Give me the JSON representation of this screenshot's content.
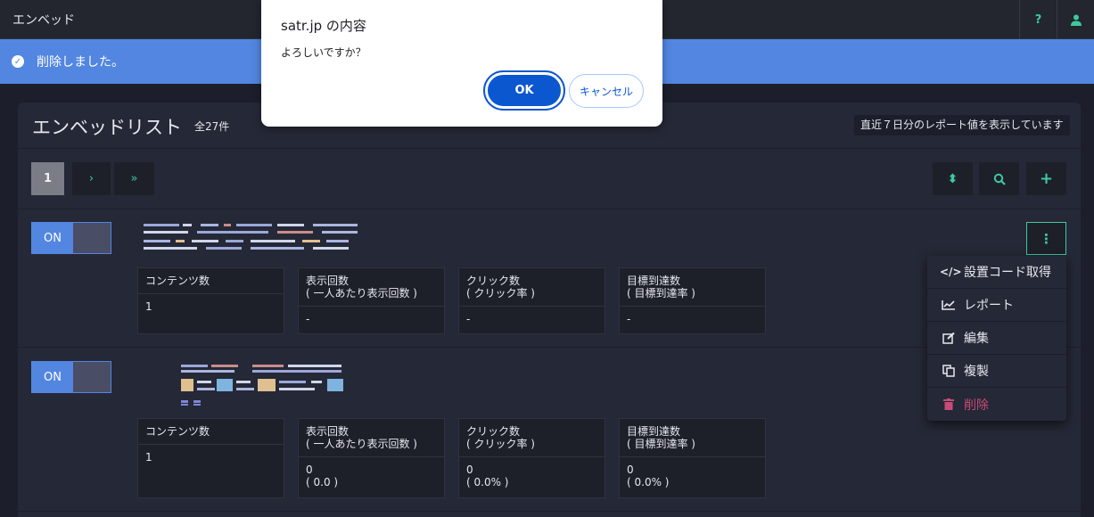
{
  "topbar": {
    "title": "エンベッド",
    "help_label": "?",
    "user_icon": "user-icon"
  },
  "alert": {
    "message": "削除しました。",
    "icon": "check-circle-icon"
  },
  "panel": {
    "title": "エンベッドリスト",
    "count": "全27件",
    "note": "直近７日分のレポート値を表示しています"
  },
  "pager": {
    "current": "1",
    "next": "›",
    "last": "»"
  },
  "tools": {
    "sort": "⬍",
    "search": "search-icon",
    "add": "+"
  },
  "rows": [
    {
      "toggle": "ON",
      "stats": [
        {
          "header": "コンテンツ数",
          "sub": "",
          "value": "1",
          "value2": ""
        },
        {
          "header": "表示回数",
          "sub": "( 一人あたり表示回数 )",
          "value": "-",
          "value2": ""
        },
        {
          "header": "クリック数",
          "sub": "( クリック率 )",
          "value": "-",
          "value2": ""
        },
        {
          "header": "目標到達数",
          "sub": "( 目標到達率 )",
          "value": "-",
          "value2": ""
        }
      ]
    },
    {
      "toggle": "ON",
      "stats": [
        {
          "header": "コンテンツ数",
          "sub": "",
          "value": "1",
          "value2": ""
        },
        {
          "header": "表示回数",
          "sub": "( 一人あたり表示回数 )",
          "value": "0",
          "value2": "( 0.0 )"
        },
        {
          "header": "クリック数",
          "sub": "( クリック率 )",
          "value": "0",
          "value2": "( 0.0% )"
        },
        {
          "header": "目標到達数",
          "sub": "( 目標到達率 )",
          "value": "0",
          "value2": "( 0.0% )"
        }
      ]
    }
  ],
  "menu": {
    "items": [
      {
        "label": "設置コード取得",
        "icon": "code-icon"
      },
      {
        "label": "レポート",
        "icon": "chart-line-icon"
      },
      {
        "label": "編集",
        "icon": "edit-icon"
      },
      {
        "label": "複製",
        "icon": "copy-icon"
      },
      {
        "label": "削除",
        "icon": "trash-icon"
      }
    ]
  },
  "dialog": {
    "title": "satr.jp の内容",
    "message": "よろしいですか？",
    "ok_label": "OK",
    "cancel_label": "キャンセル"
  },
  "colors": {
    "accent": "#3ec9a0",
    "primary": "#5286e0",
    "danger": "#c74a7a",
    "background": "#1c1f2b"
  }
}
